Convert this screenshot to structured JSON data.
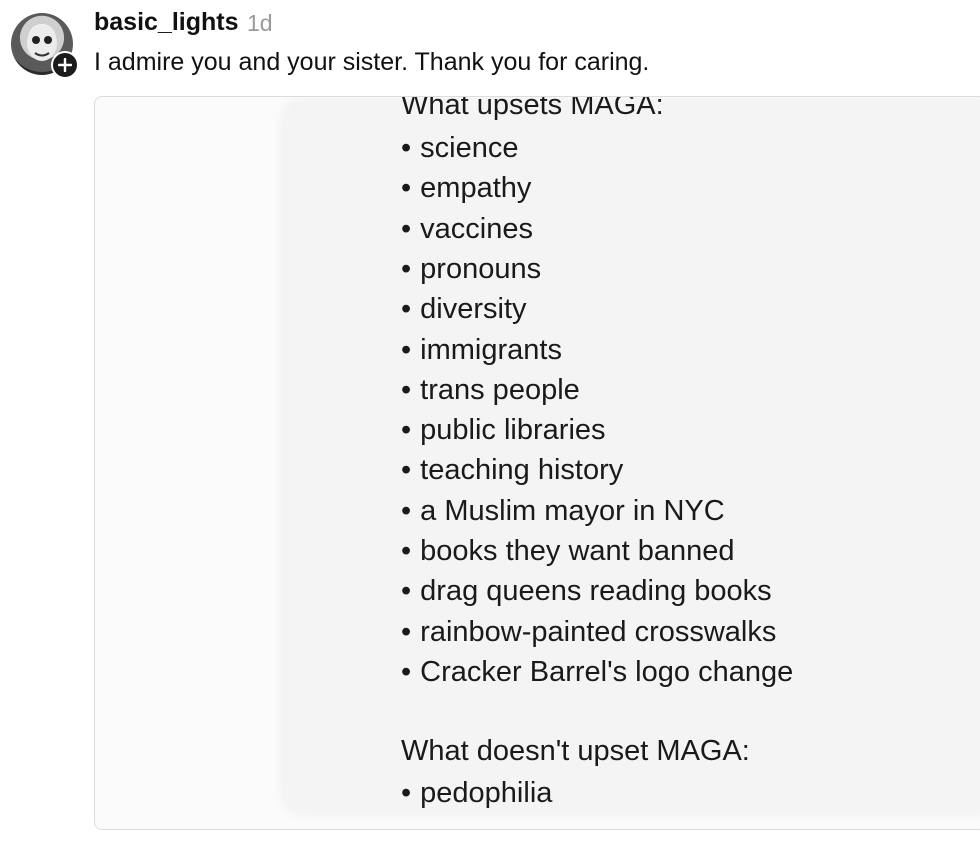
{
  "comment": {
    "username": "basic_lights",
    "timestamp": "1d",
    "text": "I admire you and your sister. Thank you for caring."
  },
  "attached_image": {
    "heading_upsets": "What upsets MAGA:",
    "upsets_items": [
      "science",
      "empathy",
      "vaccines",
      "pronouns",
      "diversity",
      "immigrants",
      "trans people",
      "public libraries",
      "teaching history",
      "a Muslim mayor in NYC",
      "books they want banned",
      "drag queens reading books",
      "rainbow-painted crosswalks",
      "Cracker Barrel's logo change"
    ],
    "heading_not_upsets": "What doesn't upset MAGA:",
    "not_upsets_items": [
      "pedophilia"
    ],
    "bullet": "•"
  },
  "icons": {
    "avatar": "avatar",
    "follow": "plus-icon"
  }
}
